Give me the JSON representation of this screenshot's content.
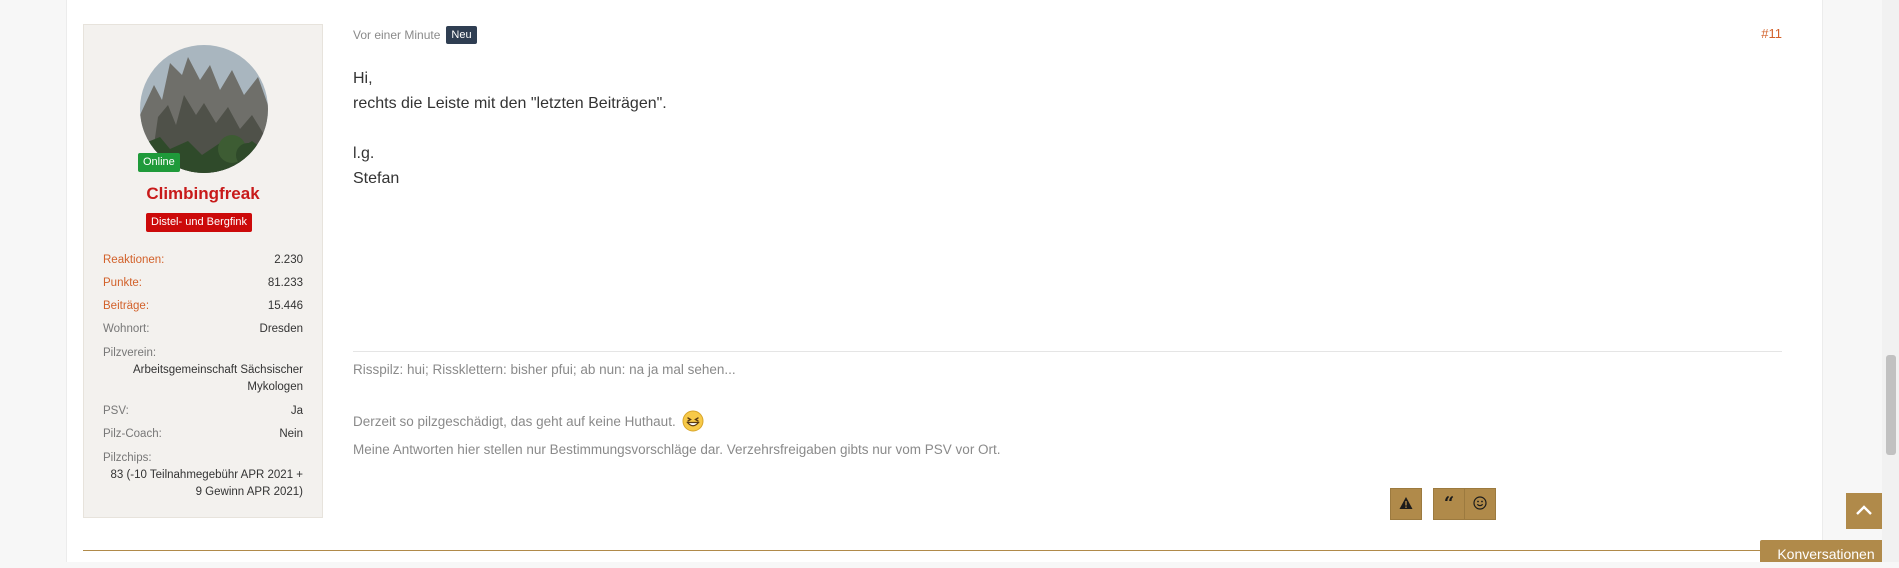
{
  "post": {
    "time": "Vor einer Minute",
    "new_badge": "Neu",
    "number": "#11",
    "message_lines": [
      "Hi,",
      "rechts die Leiste mit den \"letzten Beiträgen\".",
      "",
      "l.g.",
      "Stefan"
    ],
    "signature": {
      "line1": "Risspilz: hui; Rissklettern: bisher pfui; ab nun: na ja mal sehen...",
      "line2": "Derzeit so pilzgeschädigt, das geht auf keine Huthaut.",
      "line2_emoji": "grinning-face-icon",
      "line3": "Meine Antworten hier stellen nur Bestimmungsvorschläge dar. Verzehrsfreigaben gibts nur vom PSV vor Ort."
    }
  },
  "user": {
    "online_label": "Online",
    "name": "Climbingfreak",
    "title": "Distel- und Bergfink",
    "stats": [
      {
        "label": "Reaktionen:",
        "value": "2.230",
        "accent": true
      },
      {
        "label": "Punkte:",
        "value": "81.233",
        "accent": true
      },
      {
        "label": "Beiträge:",
        "value": "15.446",
        "accent": true
      },
      {
        "label": "Wohnort:",
        "value": "Dresden",
        "accent": false
      }
    ],
    "pilzverein_label": "Pilzverein:",
    "pilzverein_value": "Arbeitsgemeinschaft Sächsischer Mykologen",
    "psv_label": "PSV:",
    "psv_value": "Ja",
    "coach_label": "Pilz-Coach:",
    "coach_value": "Nein",
    "pilzchips_label": "Pilzchips:",
    "pilzchips_value": "83 (-10 Teilnahmegebühr APR 2021 + 9 Gewinn APR 2021)"
  },
  "actions": {
    "report_icon": "warning-icon",
    "quote_icon": "quote-icon",
    "react_icon": "smiley-icon"
  },
  "floating": {
    "scroll_top_icon": "chevron-up-icon",
    "conversations_label": "Konversationen"
  },
  "colors": {
    "accent": "#b08a4a",
    "username": "#c81a1a",
    "online": "#1f9a3a",
    "title_badge": "#cc0a0a",
    "new_badge": "#2f3e52",
    "post_number": "#d2612a"
  }
}
